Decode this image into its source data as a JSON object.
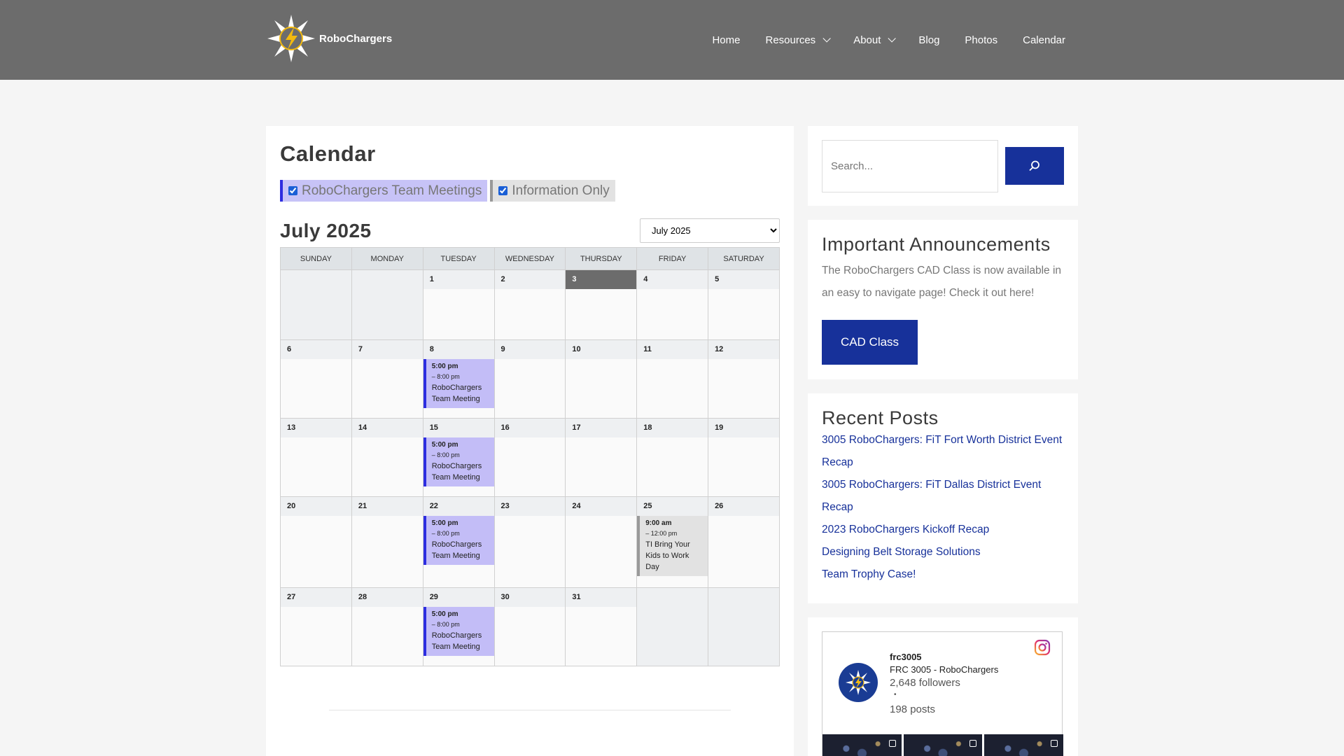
{
  "brand": {
    "name": "RoboChargers"
  },
  "nav": {
    "home": "Home",
    "resources": "Resources",
    "about": "About",
    "blog": "Blog",
    "photos": "Photos",
    "calendar": "Calendar"
  },
  "main": {
    "title": "Calendar",
    "filters": {
      "team": "RoboChargers Team Meetings",
      "info": "Information Only"
    },
    "month_title": "July 2025",
    "month_select": "July 2025",
    "weekdays": [
      "SUNDAY",
      "MONDAY",
      "TUESDAY",
      "WEDNESDAY",
      "THURSDAY",
      "FRIDAY",
      "SATURDAY"
    ],
    "today": "3",
    "events": {
      "team": {
        "start": "5:00 pm",
        "end": "– 8:00 pm",
        "name": "RoboChargers Team Meeting"
      },
      "ti": {
        "start": "9:00 am",
        "end": "– 12:00 pm",
        "name": "TI Bring Your Kids to Work Day"
      }
    }
  },
  "search": {
    "placeholder": "Search..."
  },
  "announcements": {
    "title": "Important Announcements",
    "text": "The RoboChargers CAD Class is now available in an easy to navigate page! Check it out here!",
    "button": "CAD Class"
  },
  "recent_posts": {
    "title": "Recent Posts",
    "items": [
      "3005 RoboChargers: FiT Fort Worth District Event Recap",
      "3005 RoboChargers: FiT Dallas District Event Recap",
      "2023 RoboChargers Kickoff Recap",
      "Designing Belt Storage Solutions",
      "Team Trophy Case!"
    ]
  },
  "instagram": {
    "handle": "frc3005",
    "name": "FRC 3005 - RoboChargers",
    "followers": "2,648 followers",
    "dot": "•",
    "posts": "198 posts"
  },
  "colors": {
    "header": "#6c6c6c",
    "accent": "#17319a",
    "team_event": "#c3bdf7",
    "team_border": "#2d2de0"
  }
}
